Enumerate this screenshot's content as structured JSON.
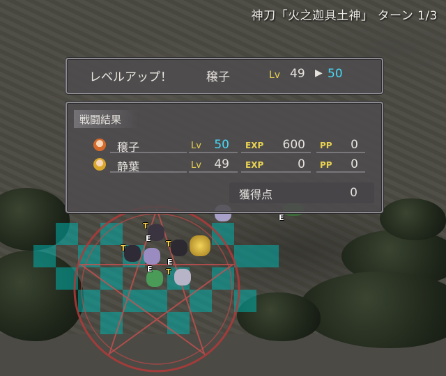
{
  "header": {
    "turn_label": "神刀「火之迦具土神」 ターン 1/3"
  },
  "level_up": {
    "title": "レベルアップ！",
    "character": "穣子",
    "lv_label": "Lv",
    "lv_from": "49",
    "arrow": "▶",
    "lv_to": "50"
  },
  "results": {
    "title": "戦闘結果",
    "rows": [
      {
        "name": "穣子",
        "lv_label": "Lv",
        "lv": "50",
        "exp_label": "EXP",
        "exp": "600",
        "pp_label": "PP",
        "pp": "0"
      },
      {
        "name": "静葉",
        "lv_label": "Lv",
        "lv": "49",
        "exp_label": "EXP",
        "exp": "0",
        "pp_label": "PP",
        "pp": "0"
      }
    ],
    "points_label": "獲得点",
    "points_value": "0"
  },
  "field_markers": [
    "T",
    "E",
    "T",
    "T",
    "E",
    "T",
    "E",
    "E"
  ],
  "colors": {
    "accent_cyan": "#47d9f5",
    "label_yellow": "#e8d252",
    "range_tile": "#00afaa"
  }
}
